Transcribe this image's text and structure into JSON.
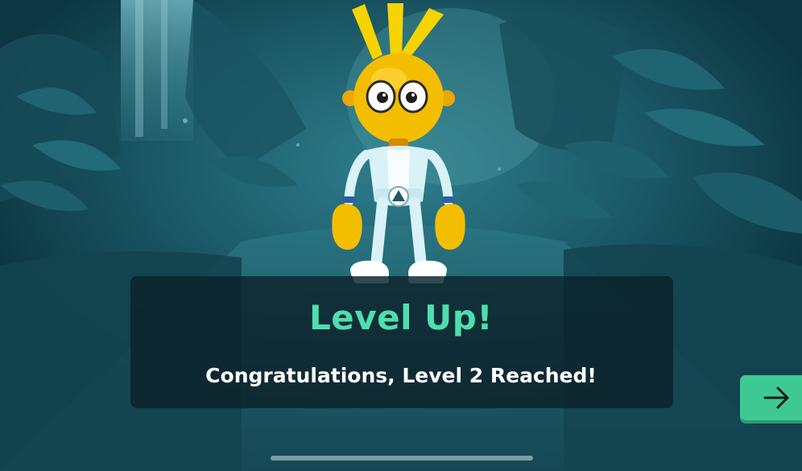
{
  "level_up": {
    "title": "Level Up!",
    "message": "Congratulations, Level 2 Reached!",
    "level": 2
  },
  "next_button": {
    "icon": "arrow-right-icon"
  },
  "colors": {
    "title": "#4fdeac",
    "button": "#3ec994",
    "character_yellow": "#f5c000",
    "suit": "#d8f2f7"
  }
}
